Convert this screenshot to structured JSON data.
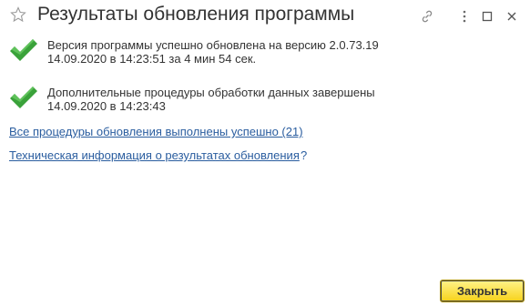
{
  "window": {
    "title": "Результаты обновления программы",
    "icons": [
      "star-icon",
      "link-icon",
      "more-icon",
      "maximize-icon",
      "close-icon"
    ]
  },
  "messages": [
    {
      "icon": "checkmark-icon",
      "line1": "Версия программы успешно обновлена на версию 2.0.73.19",
      "line2": "14.09.2020 в 14:23:51 за 4 мин 54 сек."
    },
    {
      "icon": "checkmark-icon",
      "line1": "Дополнительные процедуры обработки данных завершены",
      "line2": "14.09.2020 в 14:23:43"
    }
  ],
  "links": {
    "all_procedures": "Все процедуры обновления выполнены успешно (21)",
    "tech_info": "Техническая информация о результатах обновления",
    "help": "?"
  },
  "buttons": {
    "close": "Закрыть"
  },
  "colors": {
    "link": "#2a5d9f",
    "check": "#3aa23a",
    "button_bg": "#f7d21a",
    "text": "#333333"
  }
}
